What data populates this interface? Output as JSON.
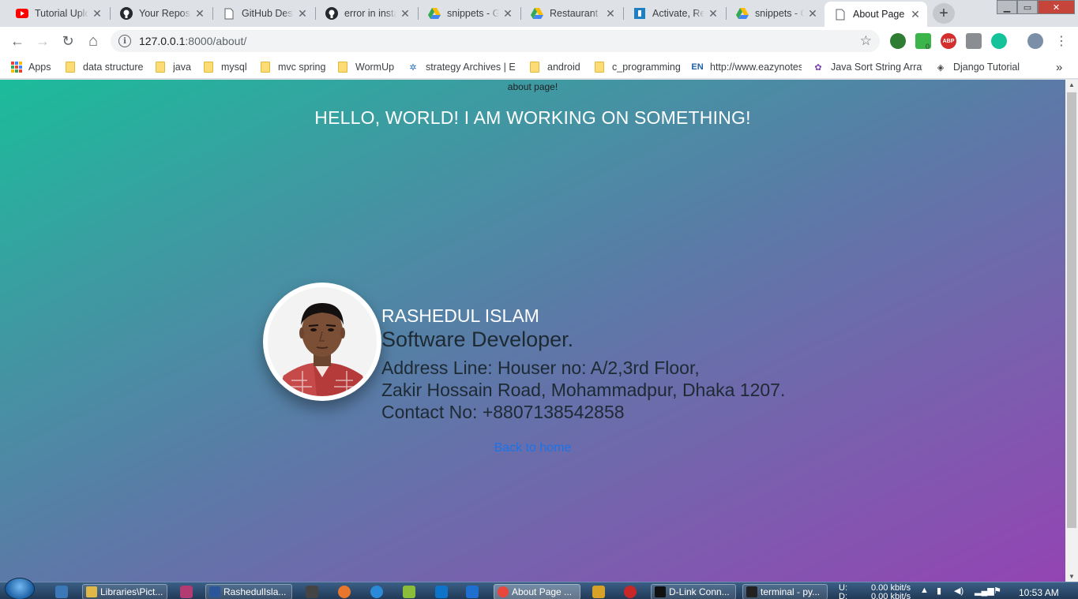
{
  "browser": {
    "tabs": [
      {
        "title": "Tutorial Uploa",
        "icon": "youtube-icon",
        "active": false
      },
      {
        "title": "Your Reposito",
        "icon": "github-icon",
        "active": false
      },
      {
        "title": "GitHub Deskto",
        "icon": "document-icon",
        "active": false
      },
      {
        "title": "error in instal",
        "icon": "github-icon",
        "active": false
      },
      {
        "title": "snippets - Goo",
        "icon": "google-drive-icon",
        "active": false
      },
      {
        "title": "Restaurant - G",
        "icon": "google-drive-icon",
        "active": false
      },
      {
        "title": "Activate, Resc",
        "icon": "app-icon",
        "active": false
      },
      {
        "title": "snippets - Goo",
        "icon": "google-drive-icon",
        "active": false
      },
      {
        "title": "About Page",
        "icon": "document-icon",
        "active": true
      }
    ],
    "new_tab": "+",
    "window_controls": {
      "minimize": "▁",
      "maximize": "▭",
      "close": "✕"
    },
    "nav": {
      "back": "←",
      "forward": "→",
      "reload": "↻",
      "home": "⌂"
    },
    "address": {
      "host": "127.0.0.1",
      "path": ":8000/about/",
      "info": "i",
      "star": "☆"
    },
    "extensions": {
      "abp": "ABP",
      "badge": "0"
    },
    "bookmarks": [
      {
        "label": "Apps",
        "icon": "apps-grid-icon"
      },
      {
        "label": "data structure",
        "icon": "folder-icon"
      },
      {
        "label": "java",
        "icon": "folder-icon"
      },
      {
        "label": "mysql",
        "icon": "folder-icon"
      },
      {
        "label": "mvc spring",
        "icon": "folder-icon"
      },
      {
        "label": "WormUp",
        "icon": "folder-icon"
      },
      {
        "label": "strategy Archives | Ex",
        "icon": "site-icon"
      },
      {
        "label": "android",
        "icon": "folder-icon"
      },
      {
        "label": "c_programming",
        "icon": "folder-icon"
      },
      {
        "label": "http://www.eazynotes",
        "icon": "site-icon"
      },
      {
        "label": "Java Sort String Array",
        "icon": "site-icon"
      },
      {
        "label": "Django Tutorial",
        "icon": "site-icon"
      }
    ],
    "bookmarks_more": "»"
  },
  "page": {
    "small_title": "about page!",
    "heading": "HELLO, WORLD! I AM WORKING ON SOMETHING!",
    "profile": {
      "name": "RASHEDUL ISLAM",
      "role": "Software Developer.",
      "address_line1": "Address Line: Houser no: A/2,3rd Floor,",
      "address_line2": "Zakir Hossain Road, Mohammadpur, Dhaka 1207.",
      "contact": "Contact No: +8807138542858"
    },
    "back_link": "Back to home"
  },
  "taskbar": {
    "items": [
      {
        "label": "Libraries\\Pict..."
      },
      {
        "label": "RashedulIsla..."
      },
      {
        "label": "About Page ..."
      },
      {
        "label": "D-Link Conn..."
      },
      {
        "label": "terminal - py..."
      }
    ],
    "network": {
      "up_label": "U:",
      "down_label": "D:",
      "up_rate": "0.00 kbit/s",
      "down_rate": "0.00 kbit/s"
    },
    "clock": "10:53 AM"
  },
  "colors": {
    "gradient_start": "#1bbc9b",
    "gradient_end": "#9344b3",
    "link": "#1a73e8"
  }
}
